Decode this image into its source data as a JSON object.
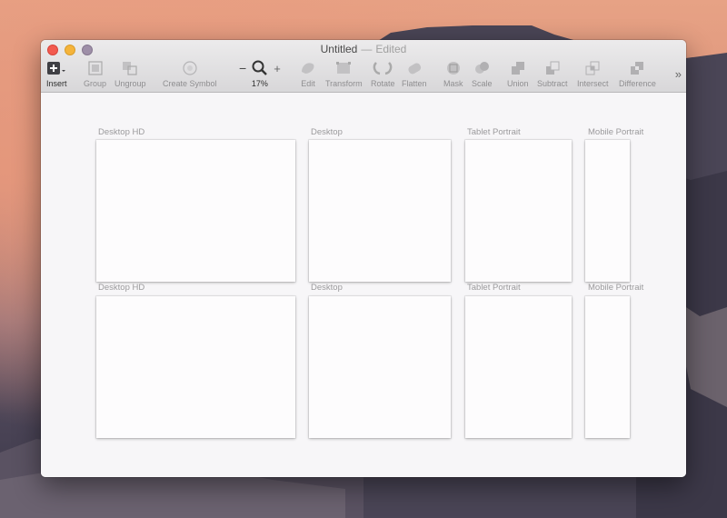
{
  "window": {
    "title": "Untitled",
    "separator": "—",
    "status": "Edited"
  },
  "toolbar": {
    "insert": "Insert",
    "group": "Group",
    "ungroup": "Ungroup",
    "create_symbol": "Create Symbol",
    "zoom_minus": "−",
    "zoom_plus": "+",
    "zoom_level": "17%",
    "edit": "Edit",
    "transform": "Transform",
    "rotate": "Rotate",
    "flatten": "Flatten",
    "mask": "Mask",
    "scale": "Scale",
    "union": "Union",
    "subtract": "Subtract",
    "intersect": "Intersect",
    "difference": "Difference",
    "more": "»"
  },
  "artboards": {
    "row1": [
      "Desktop HD",
      "Desktop",
      "Tablet Portrait",
      "Mobile Portrait"
    ],
    "row2": [
      "Desktop HD",
      "Desktop",
      "Tablet Portrait",
      "Mobile Portrait"
    ]
  },
  "colors": {
    "close": "#f25a4f",
    "minimize": "#f5b43b",
    "zoom": "#9e8fa8",
    "canvas": "#f7f6f8"
  }
}
